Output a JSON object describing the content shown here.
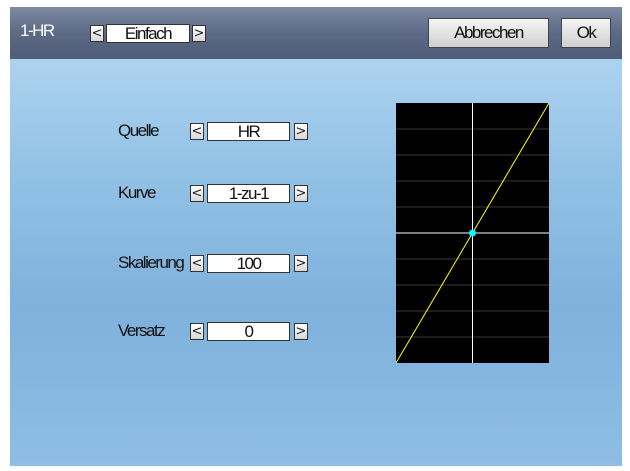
{
  "window": {
    "title": "1-HR",
    "mode_value": "Einfach",
    "left_arrow": "<",
    "right_arrow": ">"
  },
  "buttons": {
    "cancel": "Abbrechen",
    "ok": "Ok"
  },
  "fields": [
    {
      "label": "Quelle",
      "value": "HR"
    },
    {
      "label": "Kurve",
      "value": "1-zu-1"
    },
    {
      "label": "Skalierung",
      "value": "100"
    },
    {
      "label": "Versatz",
      "value": "0"
    }
  ],
  "curve_preview": {
    "type": "line",
    "curve": "1-zu-1",
    "x_range": [
      -100,
      100
    ],
    "y_range": [
      -100,
      100
    ],
    "points": [
      [
        -100,
        -100
      ],
      [
        100,
        100
      ]
    ],
    "current_point": [
      0,
      0
    ],
    "colors": {
      "background": "#000000",
      "grid": "#3a3a3a",
      "axes": "#ffffff",
      "curve": "#ffff00",
      "marker": "#00ffff"
    }
  },
  "colors": {
    "topbar": "#5c6a86",
    "screen_bg": "#93c2e6"
  }
}
